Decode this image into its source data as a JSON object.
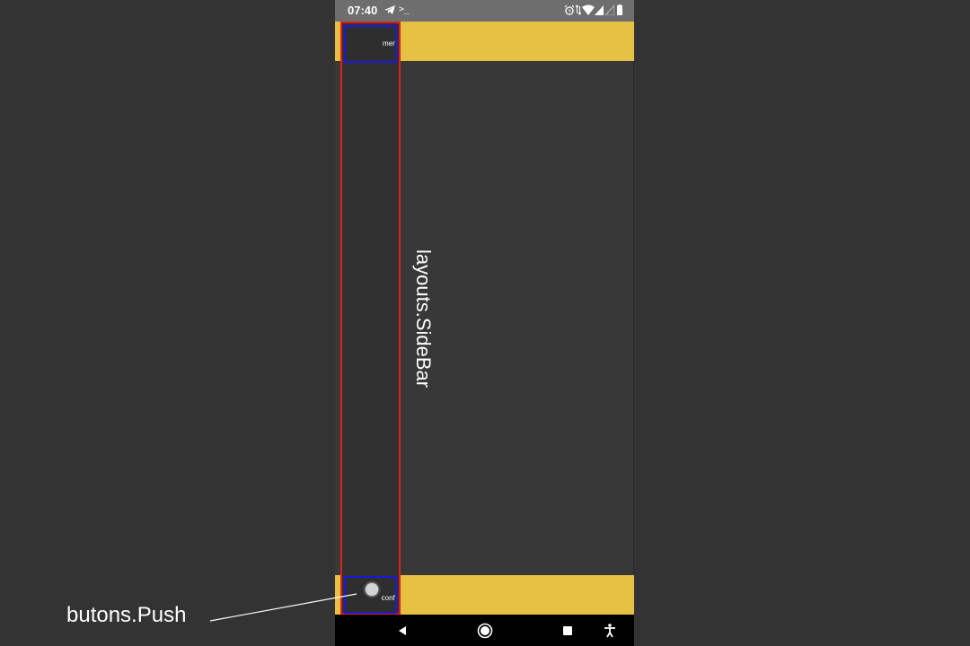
{
  "status_bar": {
    "time": "07:40",
    "terminal_glyph": ">_",
    "icons": [
      "telegram-icon",
      "terminal-icon",
      "alarm-icon",
      "data-arrows-icon",
      "wifi-icon",
      "cell-signal-icon",
      "cell-signal-empty-icon",
      "battery-icon"
    ]
  },
  "sidebar": {
    "menu_label": "menu",
    "config_label": "config"
  },
  "nav_bar": {
    "icons": [
      "back-icon",
      "home-icon",
      "recents-icon",
      "accessibility-icon"
    ]
  },
  "annotations": {
    "sidebar": "layouts.SideBar",
    "push": "butons.Push"
  },
  "colors": {
    "background": "#333333",
    "accent_bar": "#e6c042",
    "sidebar_outline": "#e11c1c",
    "button_outline": "#1a1ad6",
    "status_bar": "#6e6e6e",
    "nav_bar": "#000000"
  }
}
